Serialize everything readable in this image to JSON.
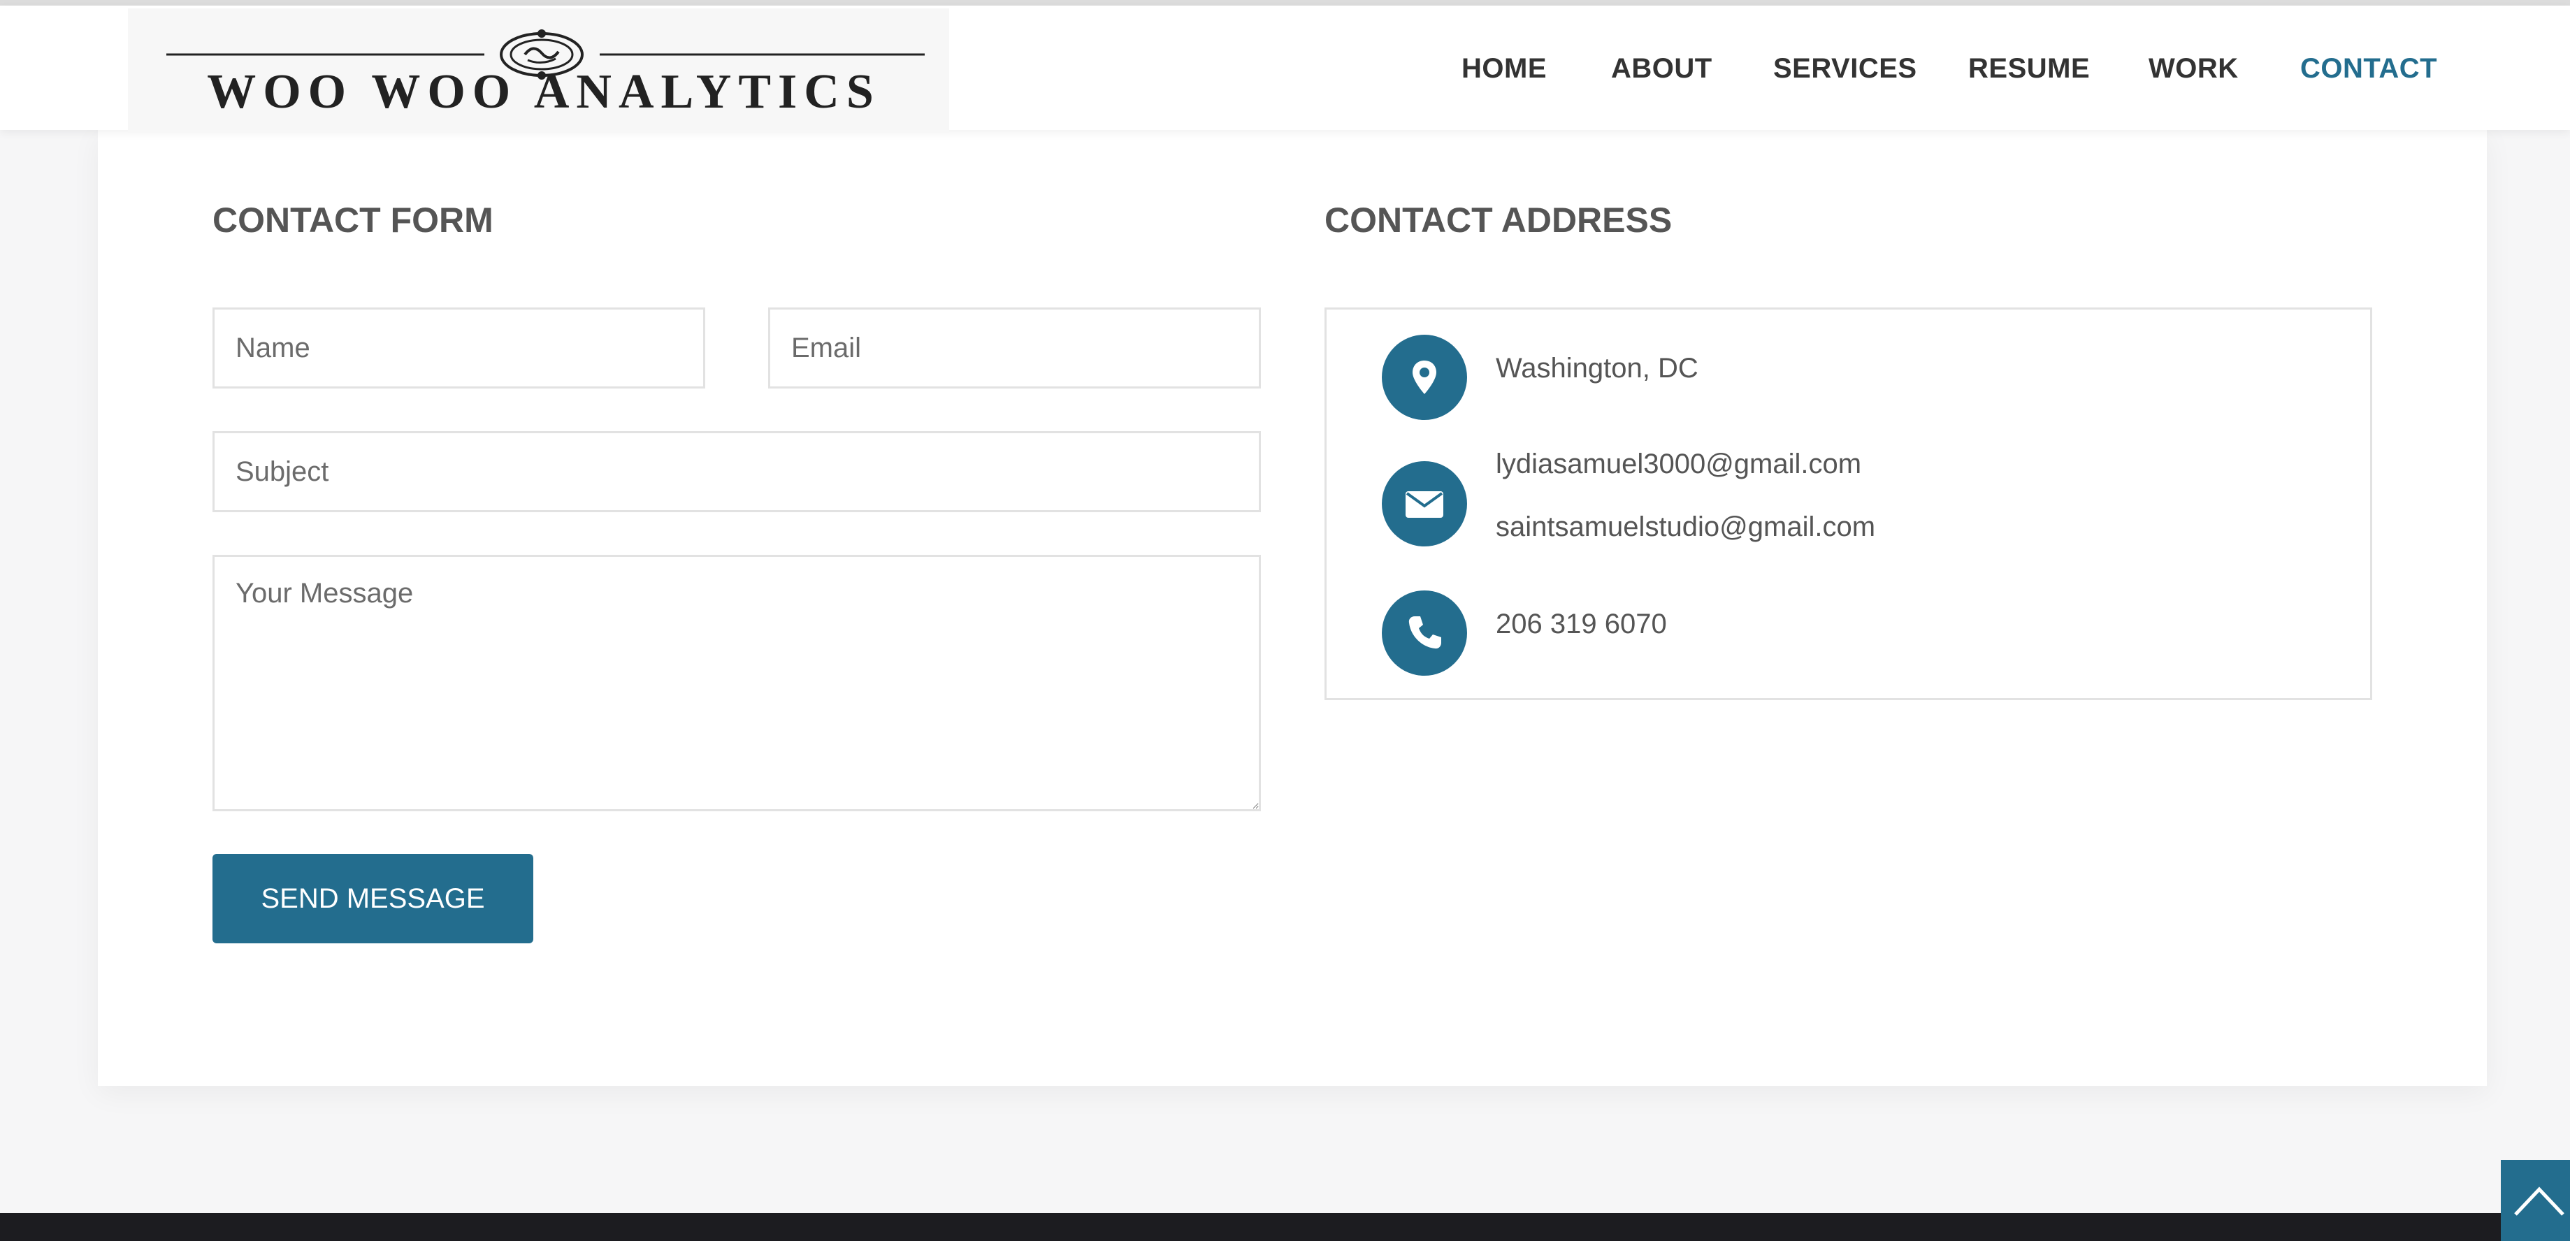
{
  "brand": {
    "logo_text": "Woo Woo Analytics"
  },
  "nav": {
    "items": [
      {
        "label": "HOME"
      },
      {
        "label": "ABOUT"
      },
      {
        "label": "SERVICES"
      },
      {
        "label": "RESUME"
      },
      {
        "label": "WORK"
      },
      {
        "label": "CONTACT",
        "active": true
      }
    ]
  },
  "contact_form": {
    "title": "CONTACT FORM",
    "name_placeholder": "Name",
    "email_placeholder": "Email",
    "subject_placeholder": "Subject",
    "message_placeholder": "Your Message",
    "submit_label": "SEND MESSAGE"
  },
  "contact_address": {
    "title": "CONTACT ADDRESS",
    "location": "Washington, DC",
    "emails": [
      "lydiasamuel3000@gmail.com",
      "saintsamuelstudio@gmail.com"
    ],
    "phone": "206 319 6070"
  },
  "icons": {
    "location": "map-marker-icon",
    "email": "envelope-icon",
    "phone": "phone-icon",
    "back_to_top": "chevron-up-icon"
  },
  "colors": {
    "accent": "#236d8e",
    "text": "#555555",
    "nav_text": "#333333",
    "footer": "#1c1c20"
  }
}
